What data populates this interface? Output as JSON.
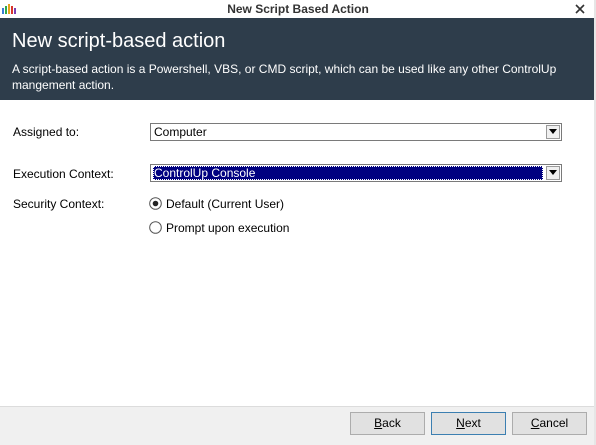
{
  "window": {
    "title": "New Script Based Action"
  },
  "header": {
    "title": "New script-based action",
    "description": "A script-based action is a Powershell, VBS, or CMD script, which can be used like any other ControlUp mangement action."
  },
  "form": {
    "assigned_to": {
      "label": "Assigned to:",
      "value": "Computer"
    },
    "execution_context": {
      "label": "Execution Context:",
      "value": "ControlUp Console"
    },
    "security_context": {
      "label": "Security Context:",
      "options": [
        {
          "label": "Default (Current User)",
          "selected": true
        },
        {
          "label": "Prompt upon execution",
          "selected": false
        }
      ]
    }
  },
  "footer": {
    "back": {
      "mnemonic": "B",
      "rest": "ack"
    },
    "next": {
      "mnemonic": "N",
      "rest": "ext"
    },
    "cancel": {
      "mnemonic": "C",
      "rest": "ancel"
    }
  },
  "icons": {
    "app": "controlup-logo-icon",
    "close": "close-icon",
    "dropdown": "chevron-down-icon"
  },
  "colors": {
    "header_bg": "#2e3d4b",
    "selection": "#000080",
    "footer_bg": "#f0f0f0"
  }
}
